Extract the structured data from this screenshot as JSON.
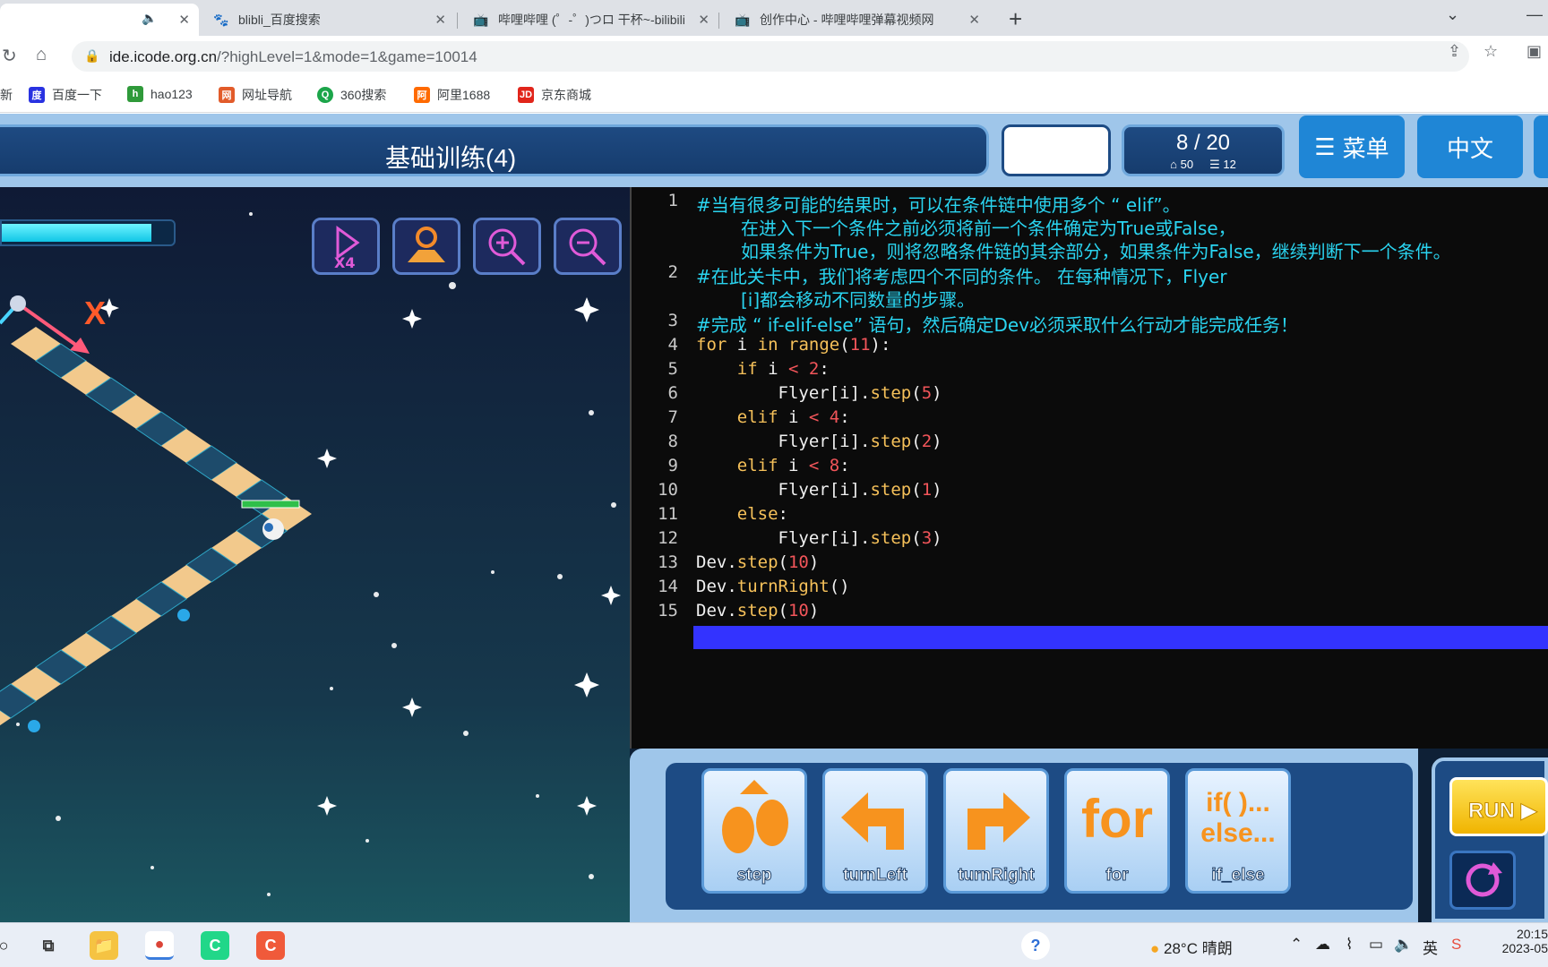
{
  "tabs": [
    {
      "title": "",
      "active": true
    },
    {
      "title": "blibli_百度搜索"
    },
    {
      "title": "哔哩哔哩 (゜-゜)つロ 干杯~-bilibili"
    },
    {
      "title": "创作中心 - 哔哩哔哩弹幕视频网"
    }
  ],
  "address": {
    "host": "ide.icode.org.cn",
    "path": "/?highLevel=1&mode=1&game=10014"
  },
  "bookmarks": [
    {
      "label": "新",
      "icon_color": "#ffffff"
    },
    {
      "label": "百度一下",
      "icon_color": "#2932e1"
    },
    {
      "label": "hao123",
      "icon_color": "#2f9a3a"
    },
    {
      "label": "网址导航",
      "icon_color": "#e25b2a"
    },
    {
      "label": "360搜索",
      "icon_color": "#1ca54a"
    },
    {
      "label": "阿里1688",
      "icon_color": "#ff6a00"
    },
    {
      "label": "京东商城",
      "icon_color": "#e1251b"
    }
  ],
  "game": {
    "title": "基础训练(4)",
    "progress": "8 / 20",
    "energy_count": "50",
    "lines_count": "12",
    "menu_label": "菜单",
    "lang_label": "中文",
    "energy_level": 0.87,
    "axis_label": "X"
  },
  "tools": [
    "speed-x4-icon",
    "map-pin-icon",
    "zoom-in-icon",
    "zoom-out-icon"
  ],
  "tool_speed_text": "X4",
  "code": {
    "comment_lines": [
      "#当有很多可能的结果时，可以在条件链中使用多个 “ elif”。",
      "在进入下一个条件之前必须将前一个条件确定为True或False，",
      "如果条件为True，则将忽略条件链的其余部分，如果条件为False，继续判断下一个条件。",
      "#在此关卡中，我们将考虑四个不同的条件。 在每种情况下，Flyer",
      "[i]都会移动不同数量的步骤。",
      "#完成 “ if-elif-else” 语句，然后确定Dev必须采取什么行动才能完成任务！"
    ],
    "line_numbers": [
      "1",
      "2",
      "3",
      "4",
      "5",
      "6",
      "7",
      "8",
      "9",
      "10",
      "11",
      "12",
      "13",
      "14",
      "15"
    ],
    "highlighted_line": 13
  },
  "blocks": [
    {
      "label": "step"
    },
    {
      "label": "turnLeft"
    },
    {
      "label": "turnRight"
    },
    {
      "label": "for",
      "icon_text": "for"
    },
    {
      "label": "if_else",
      "icon_text_1": "if( )...",
      "icon_text_2": "else..."
    }
  ],
  "run_label": "RUN",
  "taskbar": {
    "weather": "28°C  晴朗",
    "ime": "英",
    "time": "20:15",
    "date": "2023-05"
  },
  "colors": {
    "accent_blue": "#1f86d6",
    "comment": "#2ad4f0",
    "keyword": "#f6c15a",
    "number": "#f2555a",
    "highlight": "#3333ff"
  }
}
